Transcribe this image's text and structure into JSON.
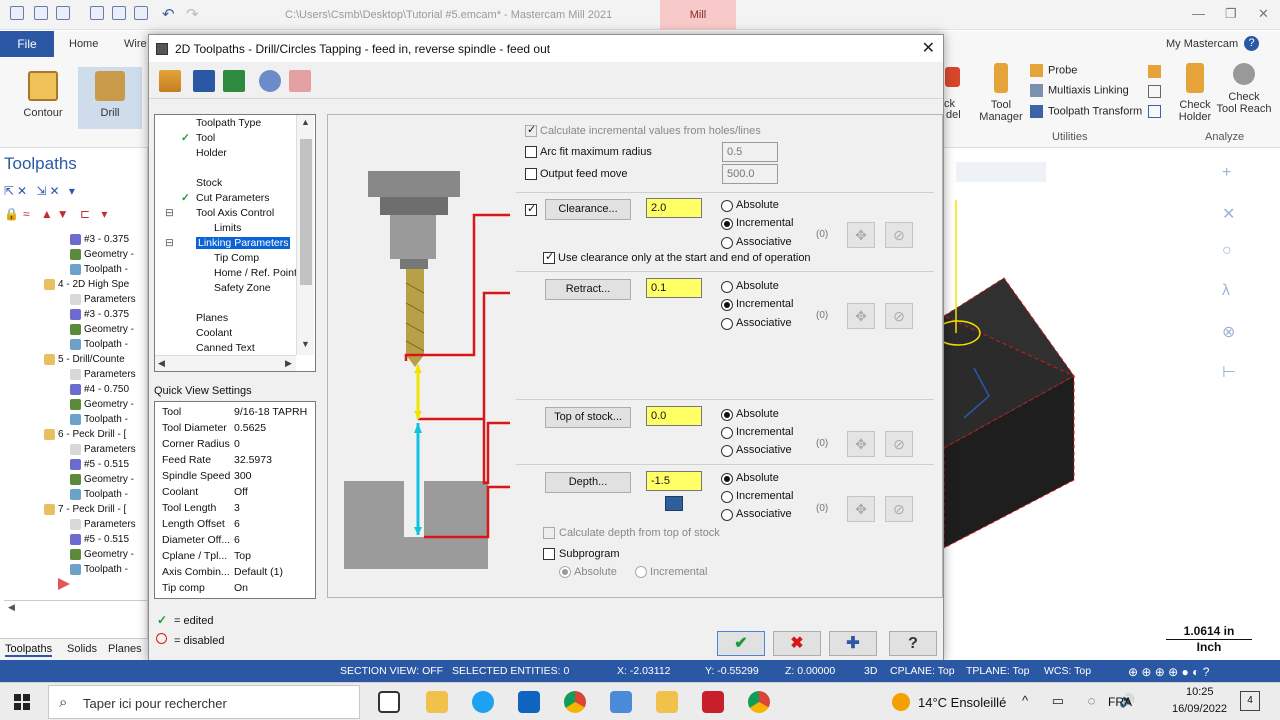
{
  "window": {
    "title": "C:\\Users\\Csmb\\Desktop\\Tutorial #5.emcam* - Mastercam Mill 2021",
    "context_tab": "Mill",
    "controls": [
      "—",
      "❐",
      "✕"
    ]
  },
  "ribbon": {
    "file_tab": "File",
    "tabs": [
      "Home",
      "Wire"
    ],
    "user": "My Mastercam",
    "contour_label": "Contour",
    "drill_label": "Drill",
    "stock_model_partial": "ck",
    "stock_model_partial2": "del",
    "tool_manager": [
      "Tool",
      "Manager"
    ],
    "probe": "Probe",
    "multiaxis_linking": "Multiaxis Linking",
    "toolpath_transform": "Toolpath Transform",
    "check_holder": [
      "Check",
      "Holder"
    ],
    "check_tool_reach": [
      "Check",
      "Tool Reach"
    ],
    "group_utilities": "Utilities",
    "group_analyze": "Analyze"
  },
  "left_panel": {
    "title": "Toolpaths",
    "tree": [
      {
        "text": "#3 - 0.375",
        "indent": 84,
        "color": "#6b6bd0"
      },
      {
        "text": "Geometry -",
        "indent": 84,
        "color": "#5a8a3a"
      },
      {
        "text": "Toolpath -",
        "indent": 84,
        "color": "#6da2c8"
      },
      {
        "text": "4 - 2D High Spe",
        "indent": 58,
        "color": "#e8c060"
      },
      {
        "text": "Parameters",
        "indent": 84,
        "color": "#d8d8d8"
      },
      {
        "text": "#3 - 0.375",
        "indent": 84,
        "color": "#6b6bd0"
      },
      {
        "text": "Geometry -",
        "indent": 84,
        "color": "#5a8a3a"
      },
      {
        "text": "Toolpath -",
        "indent": 84,
        "color": "#6da2c8"
      },
      {
        "text": "5 - Drill/Counte",
        "indent": 58,
        "color": "#e8c060"
      },
      {
        "text": "Parameters",
        "indent": 84,
        "color": "#d8d8d8"
      },
      {
        "text": "#4 - 0.750",
        "indent": 84,
        "color": "#6b6bd0"
      },
      {
        "text": "Geometry -",
        "indent": 84,
        "color": "#5a8a3a"
      },
      {
        "text": "Toolpath -",
        "indent": 84,
        "color": "#6da2c8"
      },
      {
        "text": "6 - Peck Drill - [",
        "indent": 58,
        "color": "#e8c060"
      },
      {
        "text": "Parameters",
        "indent": 84,
        "color": "#d8d8d8"
      },
      {
        "text": "#5 - 0.515",
        "indent": 84,
        "color": "#6b6bd0"
      },
      {
        "text": "Geometry -",
        "indent": 84,
        "color": "#5a8a3a"
      },
      {
        "text": "Toolpath -",
        "indent": 84,
        "color": "#6da2c8"
      },
      {
        "text": "7 - Peck Drill - [",
        "indent": 58,
        "color": "#e8c060"
      },
      {
        "text": "Parameters",
        "indent": 84,
        "color": "#d8d8d8"
      },
      {
        "text": "#5 - 0.515",
        "indent": 84,
        "color": "#6b6bd0"
      },
      {
        "text": "Geometry -",
        "indent": 84,
        "color": "#5a8a3a"
      },
      {
        "text": "Toolpath -",
        "indent": 84,
        "color": "#6da2c8"
      }
    ],
    "bottom_tabs": [
      "Toolpaths",
      "Solids",
      "Planes"
    ]
  },
  "dialog": {
    "title": "2D Toolpaths - Drill/Circles Tapping - feed in, reverse spindle - feed out",
    "close": "✕",
    "nav": {
      "items": [
        {
          "label": "Toolpath Type",
          "check": false
        },
        {
          "label": "Tool",
          "check": true
        },
        {
          "label": "Holder",
          "check": false
        },
        {
          "label": "Stock",
          "check": false
        },
        {
          "label": "Cut Parameters",
          "check": true
        },
        {
          "label": "Tool Axis Control",
          "check": false
        },
        {
          "label": "Limits",
          "check": false
        },
        {
          "label": "Linking Parameters",
          "check": false
        },
        {
          "label": "Tip Comp",
          "check": false
        },
        {
          "label": "Home / Ref. Points",
          "check": false
        },
        {
          "label": "Safety Zone",
          "check": false
        },
        {
          "label": "Planes",
          "check": false
        },
        {
          "label": "Coolant",
          "check": false
        },
        {
          "label": "Canned Text",
          "check": false
        }
      ]
    },
    "quick_view": {
      "title": "Quick View Settings",
      "rows": [
        {
          "key": "Tool",
          "value": "9/16-18 TAPRH"
        },
        {
          "key": "Tool Diameter",
          "value": "0.5625"
        },
        {
          "key": "Corner Radius",
          "value": "0"
        },
        {
          "key": "Feed Rate",
          "value": "32.5973"
        },
        {
          "key": "Spindle Speed",
          "value": "300"
        },
        {
          "key": "Coolant",
          "value": "Off"
        },
        {
          "key": "Tool Length",
          "value": "3"
        },
        {
          "key": "Length Offset",
          "value": "6"
        },
        {
          "key": "Diameter Off...",
          "value": "6"
        },
        {
          "key": "Cplane / Tpl...",
          "value": "Top"
        },
        {
          "key": "Axis Combin...",
          "value": "Default (1)"
        },
        {
          "key": "Tip comp",
          "value": "On"
        }
      ]
    },
    "legend": {
      "edited": "= edited",
      "disabled": "= disabled"
    },
    "params": {
      "calc_incremental": "Calculate incremental values from holes/lines",
      "arc_fit": "Arc fit maximum radius",
      "arc_fit_value": "0.5",
      "output_feed": "Output feed move",
      "output_feed_value": "500.0",
      "clearance_btn": "Clearance...",
      "clearance_value": "2.0",
      "use_clearance": "Use clearance only at the start and end of operation",
      "retract_btn": "Retract...",
      "retract_value": "0.1",
      "top_stock_btn": "Top of stock...",
      "top_stock_value": "0.0",
      "depth_btn": "Depth...",
      "depth_value": "-1.5",
      "calc_depth": "Calculate depth from top of stock",
      "subprogram": "Subprogram",
      "absolute": "Absolute",
      "incremental": "Incremental",
      "associative": "Associative",
      "assoc_count": "(0)"
    },
    "buttons": {
      "ok": "✔",
      "cancel": "✖",
      "add": "✚",
      "help": "?"
    }
  },
  "view": {
    "scale": "1.0614 in",
    "scale_unit": "Inch"
  },
  "statusbar": {
    "section_view": "SECTION VIEW: OFF",
    "selected": "SELECTED ENTITIES: 0",
    "x": "X:  -2.03112",
    "y": "Y:  -0.55299",
    "z": "Z:  0.00000",
    "mode": "3D",
    "cplane": "CPLANE: Top",
    "tplane": "TPLANE: Top",
    "wcs": "WCS: Top"
  },
  "taskbar": {
    "search_placeholder": "Taper ici pour rechercher",
    "weather": "14°C  Ensoleillé",
    "lang": "FRA",
    "time": "10:25",
    "date": "16/09/2022",
    "notifications": "4"
  },
  "colors": {
    "accent": "#2b58a5",
    "selection": "#0a64d6",
    "highlight_field": "#ffff66",
    "check": "#1c9a3b",
    "linking_red": "#d81818"
  }
}
